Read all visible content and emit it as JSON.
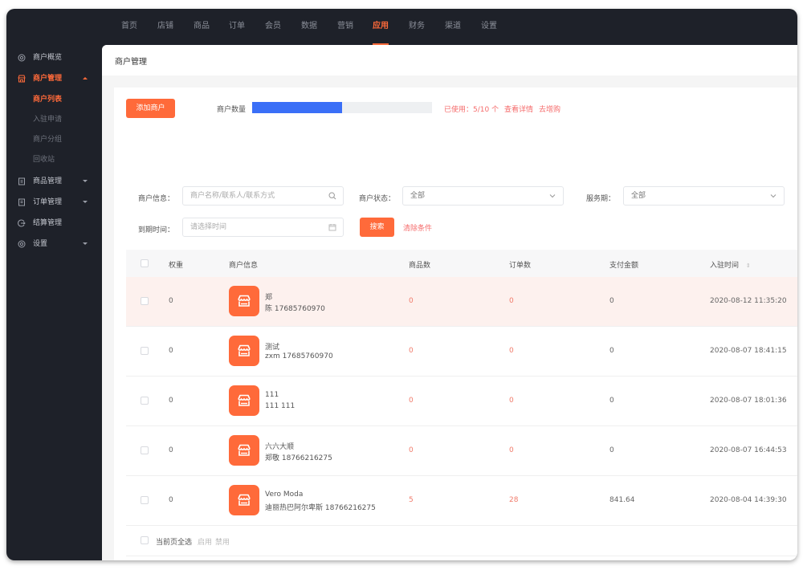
{
  "topnav": {
    "items": [
      {
        "label": "首页",
        "active": false
      },
      {
        "label": "店铺",
        "active": false
      },
      {
        "label": "商品",
        "active": false
      },
      {
        "label": "订单",
        "active": false
      },
      {
        "label": "会员",
        "active": false
      },
      {
        "label": "数据",
        "active": false
      },
      {
        "label": "营销",
        "active": false
      },
      {
        "label": "应用",
        "active": true
      },
      {
        "label": "财务",
        "active": false
      },
      {
        "label": "渠道",
        "active": false
      },
      {
        "label": "设置",
        "active": false
      }
    ],
    "accent_color": "#ff6a3a"
  },
  "sidebar": {
    "items": [
      {
        "label": "商户概览",
        "icon": "gear-icon"
      },
      {
        "label": "商户管理",
        "icon": "store-icon",
        "expanded": true,
        "children": [
          {
            "label": "商户列表",
            "active": true
          },
          {
            "label": "入驻申请"
          },
          {
            "label": "商户分组"
          },
          {
            "label": "回收站"
          }
        ]
      },
      {
        "label": "商品管理",
        "icon": "document-icon",
        "expandable": true
      },
      {
        "label": "订单管理",
        "icon": "list-icon",
        "expandable": true
      },
      {
        "label": "结算管理",
        "icon": "settlement-icon"
      },
      {
        "label": "设置",
        "icon": "settings-icon",
        "expandable": true
      }
    ]
  },
  "page": {
    "title": "商户管理",
    "add_button": "添加商户",
    "quota": {
      "label": "商户数量",
      "used": 5,
      "total": 10,
      "fraction": 0.5,
      "text": "已使用：5/10 个",
      "details_link": "查看详情",
      "buy_link": "去增购"
    }
  },
  "filters": {
    "merchant_info": {
      "label": "商户信息：",
      "placeholder": "商户名称/联系人/联系方式"
    },
    "merchant_status": {
      "label": "商户状态：",
      "value": "全部"
    },
    "service_period": {
      "label": "服务期：",
      "value": "全部"
    },
    "expire_time": {
      "label": "到期时间：",
      "placeholder": "请选择时间"
    },
    "search_button": "搜索",
    "clear_link": "清除条件"
  },
  "table": {
    "headers": {
      "weight": "权重",
      "merchant": "商户信息",
      "products": "商品数",
      "orders": "订单数",
      "paid": "支付金额",
      "joined": "入驻时间"
    },
    "rows": [
      {
        "weight": "0",
        "name": "郑",
        "contact": "陈 17685760970",
        "products": "0",
        "orders": "0",
        "paid": "0",
        "joined": "2020-08-12 11:35:20",
        "highlighted": true
      },
      {
        "weight": "0",
        "name": "测试",
        "contact": "zxm 17685760970",
        "products": "0",
        "orders": "0",
        "paid": "0",
        "joined": "2020-08-07 18:41:15"
      },
      {
        "weight": "0",
        "name": "111",
        "contact": "111 111",
        "products": "0",
        "orders": "0",
        "paid": "0",
        "joined": "2020-08-07 18:01:36"
      },
      {
        "weight": "0",
        "name": "六六大顺",
        "contact": "郑敬 18766216275",
        "products": "0",
        "orders": "0",
        "paid": "0",
        "joined": "2020-08-07 16:44:53"
      },
      {
        "weight": "0",
        "name": "Vero Moda",
        "contact": "迪丽热巴阿尔卑斯 18766216275",
        "products": "5",
        "orders": "28",
        "paid": "841.64",
        "joined": "2020-08-04 14:39:30"
      }
    ],
    "footer": {
      "select_all": "当前页全选",
      "enable": "启用",
      "disable": "禁用"
    }
  }
}
